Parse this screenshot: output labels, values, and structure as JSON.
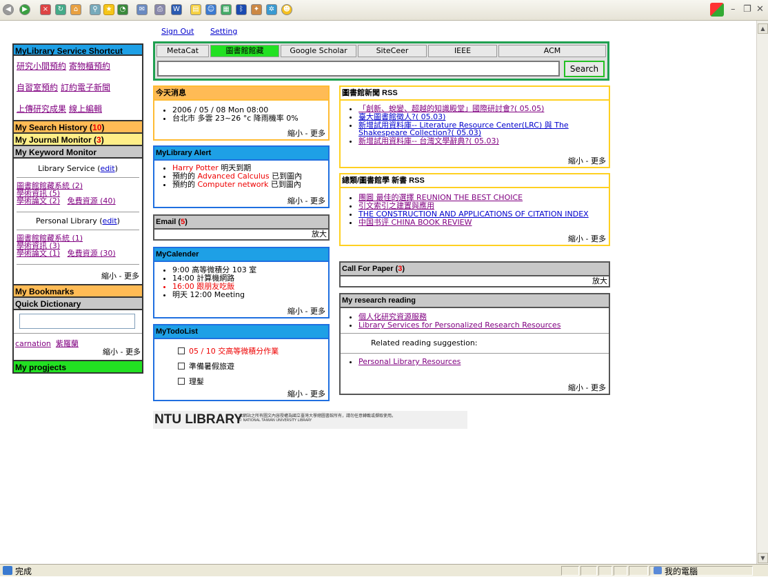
{
  "status": {
    "done": "完成",
    "zone": "我的電腦"
  },
  "nav": {
    "signout": "Sign Out",
    "setting": "Setting"
  },
  "shortcut": {
    "title": "MyLibrary Service Shortcut",
    "row1": [
      "研究小間預約",
      "寄物櫃預約"
    ],
    "row2": [
      "自習室預約",
      "訂約電子新聞"
    ],
    "row3": [
      "上傳研究成果",
      "線上編輯"
    ]
  },
  "history": {
    "label": "My Search History (",
    "count": "10",
    "close": ")"
  },
  "journal": {
    "label": "My Journal Monitor (",
    "count": "3",
    "close": ")"
  },
  "keyword": {
    "title": "My Keyword Monitor",
    "lib_label": "Library Service (",
    "edit": "edit",
    "close": ")",
    "lib_links": [
      "圖書館館藏系統 (2)",
      "學術資訊 (5)",
      "學術論文 (2)",
      "免費資源 (40)"
    ],
    "personal_label": "Personal Library (",
    "personal_links": [
      "圖書館館藏系統 (1)",
      "學術資訊 (3)",
      "學術論文 (1)",
      "免費資源 (30)"
    ],
    "footer": "縮小 - 更多"
  },
  "bookmarks": {
    "title": "My Bookmarks"
  },
  "dictionary": {
    "title": "Quick Dictionary",
    "value": "",
    "w1": "carnation",
    "w2": "紫羅蘭",
    "footer": "縮小 - 更多"
  },
  "projects": {
    "title": "My progjects"
  },
  "search": {
    "tabs": [
      "MetaCat",
      "圖書館館藏",
      "Google Scholar",
      "SiteCeer",
      "IEEE",
      "ACM"
    ],
    "button": "Search",
    "value": ""
  },
  "today": {
    "title": "今天消息",
    "items": [
      "2006 / 05 / 08 Mon 08:00",
      "台北市 多雲 23~26 °c 降雨機率 0%"
    ],
    "footer": "縮小 - 更多"
  },
  "alert": {
    "title": "MyLibrary Alert",
    "i1a": "Harry Potter",
    "i1b": " 明天到期",
    "i2a": "預約的 ",
    "i2b": "Advanced Calculus",
    "i2c": " 已到圖內",
    "i3a": "預約的 ",
    "i3b": "Computer network",
    "i3c": " 已到圖內",
    "footer": "縮小 - 更多"
  },
  "email": {
    "label": "Email (",
    "count": "5",
    "close": ")",
    "expand": "放大"
  },
  "calendar": {
    "title": "MyCalender",
    "items": [
      "9:00 高等微積分 103 室",
      "14:00 計算機網路",
      "16:00 跟朋友吃飯",
      "明天 12:00 Meeting"
    ],
    "footer": "縮小 - 更多"
  },
  "todo": {
    "title": "MyTodoList",
    "items": [
      "05 / 10 交高等微積分作業",
      "準備暑假旅遊",
      "理髮"
    ],
    "footer": "縮小 - 更多"
  },
  "news": {
    "title": "圖書館新聞 RSS",
    "items": [
      "「創新、蛻變、超越的知識殿堂」國際研討會?( 05.05)",
      "臺大圖書館徵人?( 05.03)",
      "新增試用資料庫-- Literature Resource Center(LRC) 與 The Shakespeare Collection?( 05.03)",
      "新增試用資料庫-- 台灣文學辭典?( 05.03)"
    ],
    "footer": "縮小 - 更多"
  },
  "newbooks": {
    "title": "總類/圖書館學 新書 RSS",
    "items": [
      "團圓 最佳的選擇 REUNION THE BEST CHOICE",
      "引文索引之建置與應用",
      "THE CONSTRUCTION AND APPLICATIONS OF CITATION INDEX",
      "中国书评 CHINA BOOK REVIEW"
    ],
    "footer": "縮小 - 更多"
  },
  "cfp": {
    "label": "Call For Paper (",
    "count": "3",
    "close": ")",
    "expand": "放大"
  },
  "reading": {
    "title": "My research reading",
    "items": [
      "個人化研究資源服務",
      "Library Services for Personalized Research Resources"
    ],
    "related": "Related reading suggestion:",
    "suggest": "Personal Library Resources",
    "footer": "縮小 - 更多"
  },
  "logo": {
    "main": "NTU LIBRARY",
    "sub1": "本網站之所有圖文內容授權為國立臺灣大學總圖書館所有，請勿任意轉載或擷取使用。",
    "sub2": "© NATIONAL TAIWAN UNIVERSITY LIBRARY"
  }
}
